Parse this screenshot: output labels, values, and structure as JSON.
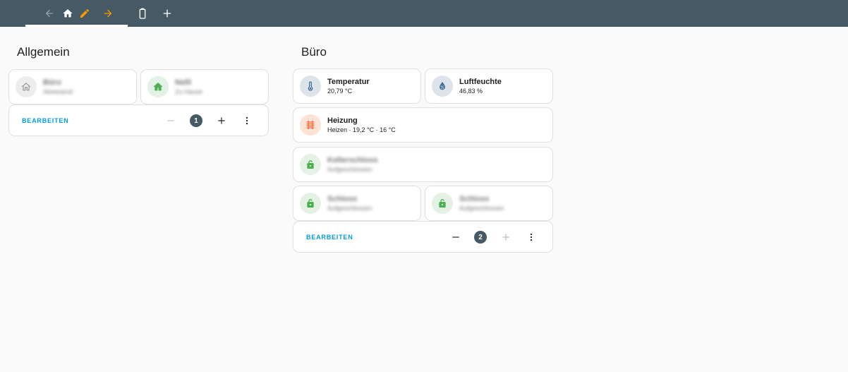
{
  "toolbar": {
    "icons": [
      "arrow-left-icon",
      "home-icon",
      "pencil-icon",
      "arrow-right-icon",
      "battery-icon",
      "plus-icon"
    ],
    "accent": "#ff9800",
    "bar_color": "#455a64"
  },
  "sections": [
    {
      "title": "Allgemein",
      "tiles": [
        {
          "name": "Büro",
          "state": "Abwesend",
          "icon": "home-outline-icon",
          "icon_bg": "#ededed",
          "icon_color": "#9e9e9e"
        },
        {
          "name": "Nelli",
          "state": "Zu Hause",
          "icon": "home-icon",
          "icon_bg": "#e3f2e4",
          "icon_color": "#4caf50"
        }
      ],
      "footer": {
        "edit_label": "BEARBEITEN",
        "position": "1"
      }
    },
    {
      "title": "Büro",
      "tiles": [
        {
          "name": "Temperatur",
          "state": "20,79 °C",
          "icon": "thermometer-icon",
          "icon_bg": "#dde3ea",
          "icon_color": "#44739e"
        },
        {
          "name": "Luftfeuchte",
          "state": "46,83 %",
          "icon": "water-percent-icon",
          "icon_bg": "#dde3ea",
          "icon_color": "#44739e"
        },
        {
          "name": "Heizung",
          "state": "Heizen · 19,2 °C · 16 °C",
          "icon": "radiator-icon",
          "icon_bg": "#fde2d6",
          "icon_color": "#ff7043"
        },
        {
          "name": "Kellerschloss",
          "state": "Aufgeschlossen",
          "icon": "lock-open-icon",
          "icon_bg": "#e3f2e4",
          "icon_color": "#4caf50"
        },
        {
          "name": "Schloss",
          "state": "Aufgeschlossen",
          "icon": "lock-open-icon",
          "icon_bg": "#e3f2e4",
          "icon_color": "#4caf50"
        },
        {
          "name": "Schloss",
          "state": "Aufgeschlossen",
          "icon": "lock-open-icon",
          "icon_bg": "#e3f2e4",
          "icon_color": "#4caf50"
        }
      ],
      "footer": {
        "edit_label": "BEARBEITEN",
        "position": "2"
      }
    }
  ]
}
